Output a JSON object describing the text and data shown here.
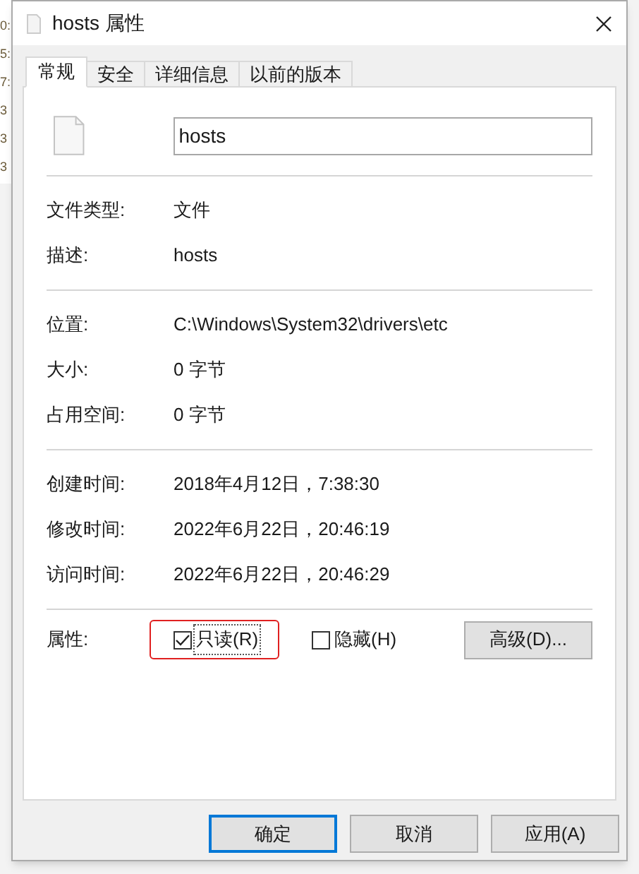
{
  "background_lines": [
    "0:",
    "5:",
    "7:",
    "3",
    "3",
    "3"
  ],
  "window": {
    "title": "hosts 属性"
  },
  "tabs": [
    {
      "label": "常规",
      "selected": true
    },
    {
      "label": "安全",
      "selected": false
    },
    {
      "label": "详细信息",
      "selected": false
    },
    {
      "label": "以前的版本",
      "selected": false
    }
  ],
  "file_name": {
    "value": "hosts"
  },
  "sections": [
    [
      {
        "label": "文件类型:",
        "value": "文件"
      },
      {
        "label": "描述:",
        "value": "hosts"
      }
    ],
    [
      {
        "label": "位置:",
        "value": "C:\\Windows\\System32\\drivers\\etc"
      },
      {
        "label": "大小:",
        "value": "0 字节"
      },
      {
        "label": "占用空间:",
        "value": "0 字节"
      }
    ],
    [
      {
        "label": "创建时间:",
        "value": "2018年4月12日，7:38:30"
      },
      {
        "label": "修改时间:",
        "value": "2022年6月22日，20:46:19"
      },
      {
        "label": "访问时间:",
        "value": "2022年6月22日，20:46:29"
      }
    ]
  ],
  "attributes": {
    "label": "属性:",
    "options": [
      {
        "label": "只读(R)",
        "checked": true,
        "focused": true,
        "highlighted": true
      },
      {
        "label": "隐藏(H)",
        "checked": false,
        "focused": false,
        "highlighted": false
      }
    ],
    "advanced_button": "高级(D)..."
  },
  "buttons": [
    {
      "label": "确定",
      "default": true
    },
    {
      "label": "取消",
      "default": false
    },
    {
      "label": "应用(A)",
      "default": false
    }
  ]
}
